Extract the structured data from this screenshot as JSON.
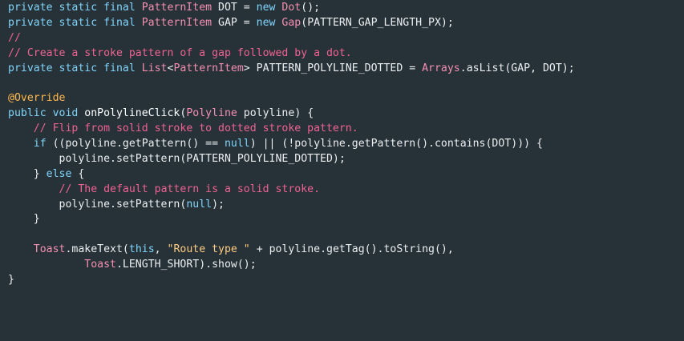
{
  "colors": {
    "background": "#263238",
    "keyword": "#81d4fa",
    "type": "#f48fb1",
    "comment": "#f06292",
    "string": "#ffcc80",
    "annotation": "#ffb74d",
    "plain": "#eceff1"
  },
  "code": {
    "lines": [
      [
        [
          "kw",
          "private static final "
        ],
        [
          "ty",
          "PatternItem"
        ],
        [
          "pl",
          " DOT = "
        ],
        [
          "kw",
          "new "
        ],
        [
          "ty",
          "Dot"
        ],
        [
          "pl",
          "();"
        ]
      ],
      [
        [
          "kw",
          "private static final "
        ],
        [
          "ty",
          "PatternItem"
        ],
        [
          "pl",
          " GAP = "
        ],
        [
          "kw",
          "new "
        ],
        [
          "ty",
          "Gap"
        ],
        [
          "pl",
          "(PATTERN_GAP_LENGTH_PX);"
        ]
      ],
      [
        [
          "cm",
          "//"
        ]
      ],
      [
        [
          "cm",
          "// Create a stroke pattern of a gap followed by a dot."
        ]
      ],
      [
        [
          "kw",
          "private static final "
        ],
        [
          "ty",
          "List"
        ],
        [
          "pl",
          "<"
        ],
        [
          "ty",
          "PatternItem"
        ],
        [
          "pl",
          "> PATTERN_POLYLINE_DOTTED = "
        ],
        [
          "ty",
          "Arrays"
        ],
        [
          "pl",
          ".asList(GAP, DOT);"
        ]
      ],
      [
        [
          "pl",
          ""
        ]
      ],
      [
        [
          "an",
          "@Override"
        ]
      ],
      [
        [
          "kw",
          "public void "
        ],
        [
          "fn",
          "onPolylineClick"
        ],
        [
          "pl",
          "("
        ],
        [
          "ty",
          "Polyline"
        ],
        [
          "pl",
          " polyline) {"
        ]
      ],
      [
        [
          "pl",
          "    "
        ],
        [
          "cm",
          "// Flip from solid stroke to dotted stroke pattern."
        ]
      ],
      [
        [
          "pl",
          "    "
        ],
        [
          "kw",
          "if "
        ],
        [
          "pl",
          "((polyline.getPattern() == "
        ],
        [
          "nl",
          "null"
        ],
        [
          "pl",
          ") || (!polyline.getPattern().contains(DOT))) {"
        ]
      ],
      [
        [
          "pl",
          "        polyline.setPattern(PATTERN_POLYLINE_DOTTED);"
        ]
      ],
      [
        [
          "pl",
          "    } "
        ],
        [
          "kw",
          "else "
        ],
        [
          "pl",
          "{"
        ]
      ],
      [
        [
          "pl",
          "        "
        ],
        [
          "cm",
          "// The default pattern is a solid stroke."
        ]
      ],
      [
        [
          "pl",
          "        polyline.setPattern("
        ],
        [
          "nl",
          "null"
        ],
        [
          "pl",
          ");"
        ]
      ],
      [
        [
          "pl",
          "    }"
        ]
      ],
      [
        [
          "pl",
          ""
        ]
      ],
      [
        [
          "pl",
          "    "
        ],
        [
          "ty",
          "Toast"
        ],
        [
          "pl",
          ".makeText("
        ],
        [
          "kw",
          "this"
        ],
        [
          "pl",
          ", "
        ],
        [
          "st",
          "\"Route type \""
        ],
        [
          "pl",
          " + polyline.getTag().toString(),"
        ]
      ],
      [
        [
          "pl",
          "            "
        ],
        [
          "ty",
          "Toast"
        ],
        [
          "pl",
          ".LENGTH_SHORT).show();"
        ]
      ],
      [
        [
          "pl",
          "}"
        ]
      ]
    ]
  }
}
